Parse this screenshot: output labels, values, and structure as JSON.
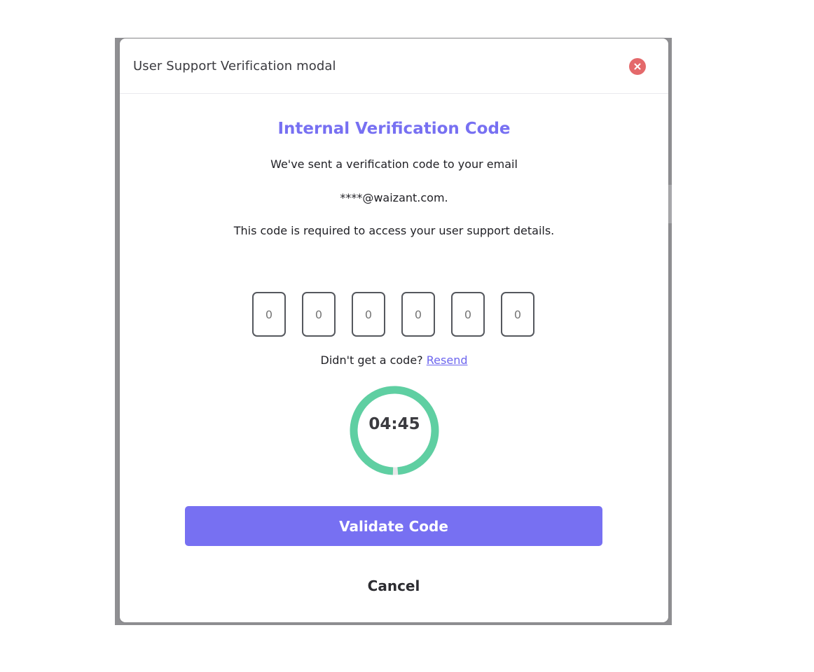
{
  "modal": {
    "title": "User Support Verification modal",
    "close_icon": "close-icon",
    "heading": "Internal Verification Code",
    "lines": [
      "We've sent a verification code to your email",
      "****@waizant.com.",
      "This code is required to access your user support details."
    ],
    "otp_placeholders": [
      "0",
      "0",
      "0",
      "0",
      "0",
      "0"
    ],
    "resend_prompt": "Didn't get a code?",
    "resend_link": "Resend",
    "timer": {
      "value": "04:45",
      "progress": 0.98
    },
    "validate_label": "Validate Code",
    "cancel_label": "Cancel"
  },
  "colors": {
    "accent": "#7770f2",
    "close": "#e4696b",
    "timer_ring": "#5fcfa2",
    "timer_track": "#e8e8ea"
  }
}
